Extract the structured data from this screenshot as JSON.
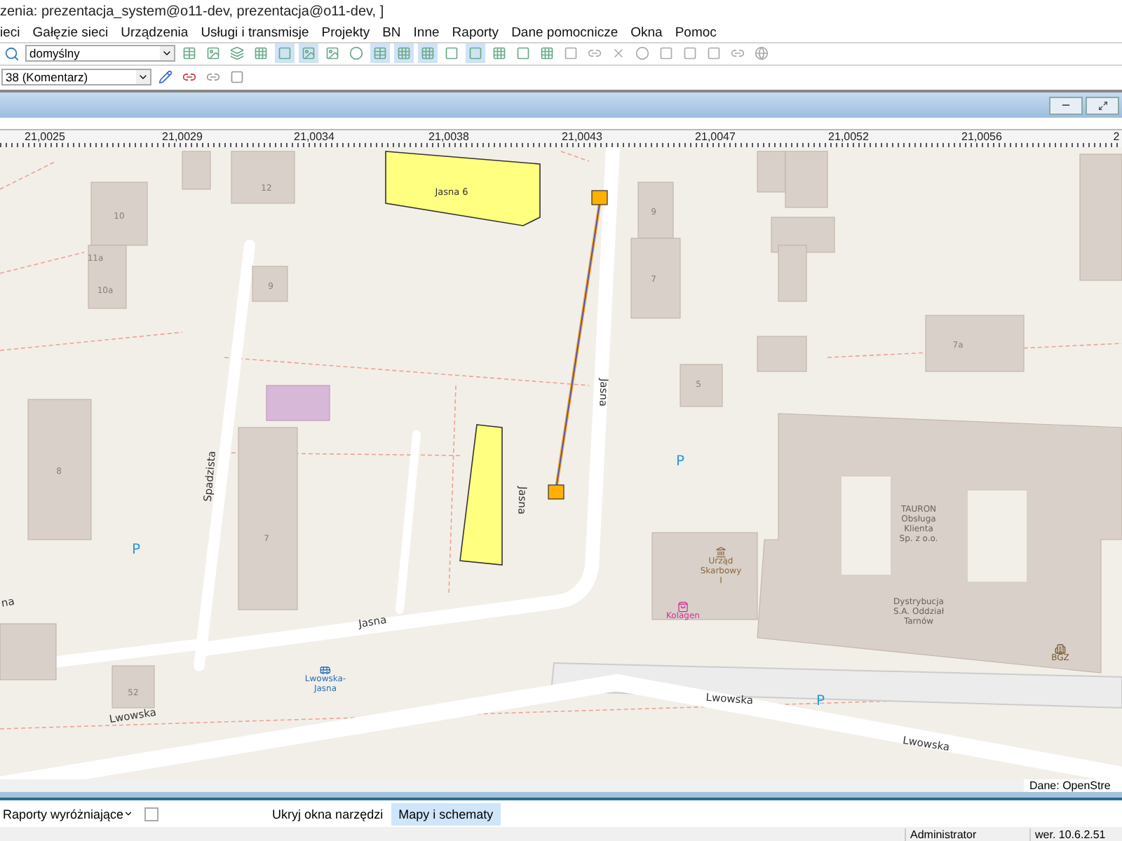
{
  "window": {
    "title": "zenia: prezentacja_system@o11-dev, prezentacja@o11-dev, ]"
  },
  "menu": [
    "ieci",
    "Gałęzie sieci",
    "Urządzenia",
    "Usługi i transmisje",
    "Projekty",
    "BN",
    "Inne",
    "Raporty",
    "Dane pomocnicze",
    "Okna",
    "Pomoc"
  ],
  "toolbar": {
    "style_select": "domyślny",
    "layer_select": "38 (Komentarz)"
  },
  "ruler": {
    "ticks": [
      "21,0025",
      "21,0029",
      "21,0034",
      "21,0038",
      "21,0043",
      "21,0047",
      "21,0052",
      "21,0056",
      "2"
    ]
  },
  "map": {
    "building_numbers": [
      "12",
      "10",
      "11a",
      "10a",
      "9",
      "8",
      "7",
      "52",
      "9",
      "7",
      "5",
      "7a"
    ],
    "building_names": [
      "Jasna 6"
    ],
    "streets": [
      "Spadzista",
      "Jasna",
      "Jasna",
      "Jasna",
      "na",
      "Lwowska",
      "Lwowska",
      "Lwowska"
    ],
    "pois": [
      {
        "kind": "office",
        "lines": [
          "Urząd",
          "Skarbowy",
          "I"
        ]
      },
      {
        "kind": "shop",
        "lines": [
          "Kolagen"
        ]
      },
      {
        "kind": "bank",
        "lines": [
          "BGZ"
        ]
      },
      {
        "kind": "bus",
        "lines": [
          "Lwowska-",
          "Jasna"
        ]
      },
      {
        "kind": "label",
        "lines": [
          "TAURON",
          "Obsługa",
          "Klienta",
          "Sp. z o.o."
        ]
      },
      {
        "kind": "label",
        "lines": [
          "Dystrybucja",
          "S.A. Oddział",
          "Tarnów"
        ]
      }
    ],
    "parking": [
      "P",
      "P",
      "P"
    ],
    "attribution": "Dane: OpenStre"
  },
  "bottom_bar": {
    "reports": "Raporty wyróżniające",
    "reports_checked": false,
    "hide_tools": "Ukryj okna narzędzi",
    "tabs": [
      {
        "label": "Mapy i schematy",
        "selected": true
      }
    ]
  },
  "status_bar": {
    "user": "Administrator",
    "version": "wer. 10.6.2.51"
  }
}
